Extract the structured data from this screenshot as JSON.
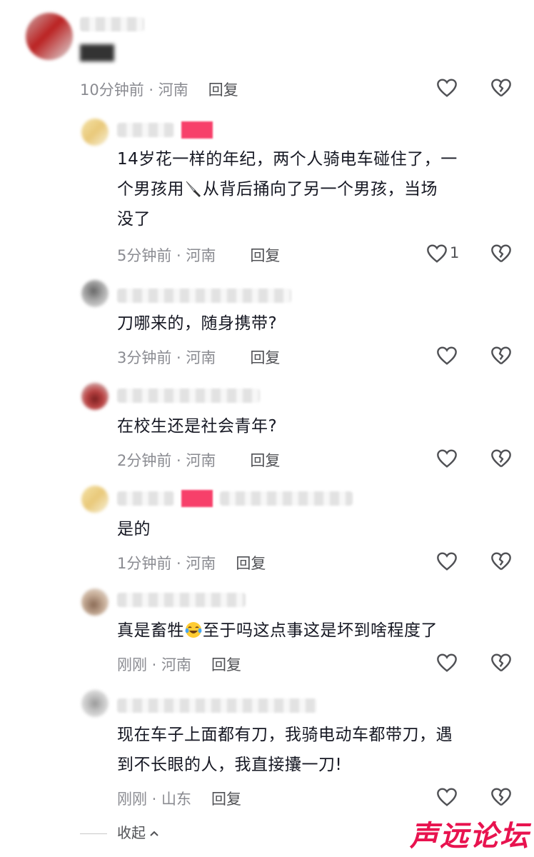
{
  "comments": [
    {
      "text_visible": "",
      "time": "10分钟前 · 河南",
      "reply": "回复",
      "likes": ""
    },
    {
      "text_line1": "14岁花一样的年纪，两个人骑电车碰住了，一",
      "text_line2a": "个男孩用",
      "text_line2b": "从背后捅向了另一个男孩，当场",
      "text_line3": "没了",
      "knife_icon": "knife-emoji",
      "time": "5分钟前 · 河南",
      "reply": "回复",
      "likes": "1"
    },
    {
      "text": "刀哪来的，随身携带?",
      "time": "3分钟前 · 河南",
      "reply": "回复",
      "likes": ""
    },
    {
      "text": "在校生还是社会青年?",
      "time": "2分钟前 · 河南",
      "reply": "回复",
      "likes": ""
    },
    {
      "text": "是的",
      "time": "1分钟前 · 河南",
      "reply": "回复",
      "likes": ""
    },
    {
      "text_a": "真是畜牲",
      "text_b": "至于吗这点事这是坏到啥程度了",
      "emoji_icon": "tears-of-joy-emoji",
      "time": "刚刚 · 河南",
      "reply": "回复",
      "likes": ""
    },
    {
      "text_line1": "现在车子上面都有刀，我骑电动车都带刀，遇",
      "text_line2": "到不长眼的人，我直接攮一刀!",
      "time": "刚刚 · 山东",
      "reply": "回复",
      "likes": ""
    }
  ],
  "collapse_label": "收起",
  "watermark": "声远论坛",
  "colors": {
    "text": "#161823",
    "meta": "#8a8b91",
    "accent": "#f7406a",
    "watermark": "#e8134f"
  }
}
